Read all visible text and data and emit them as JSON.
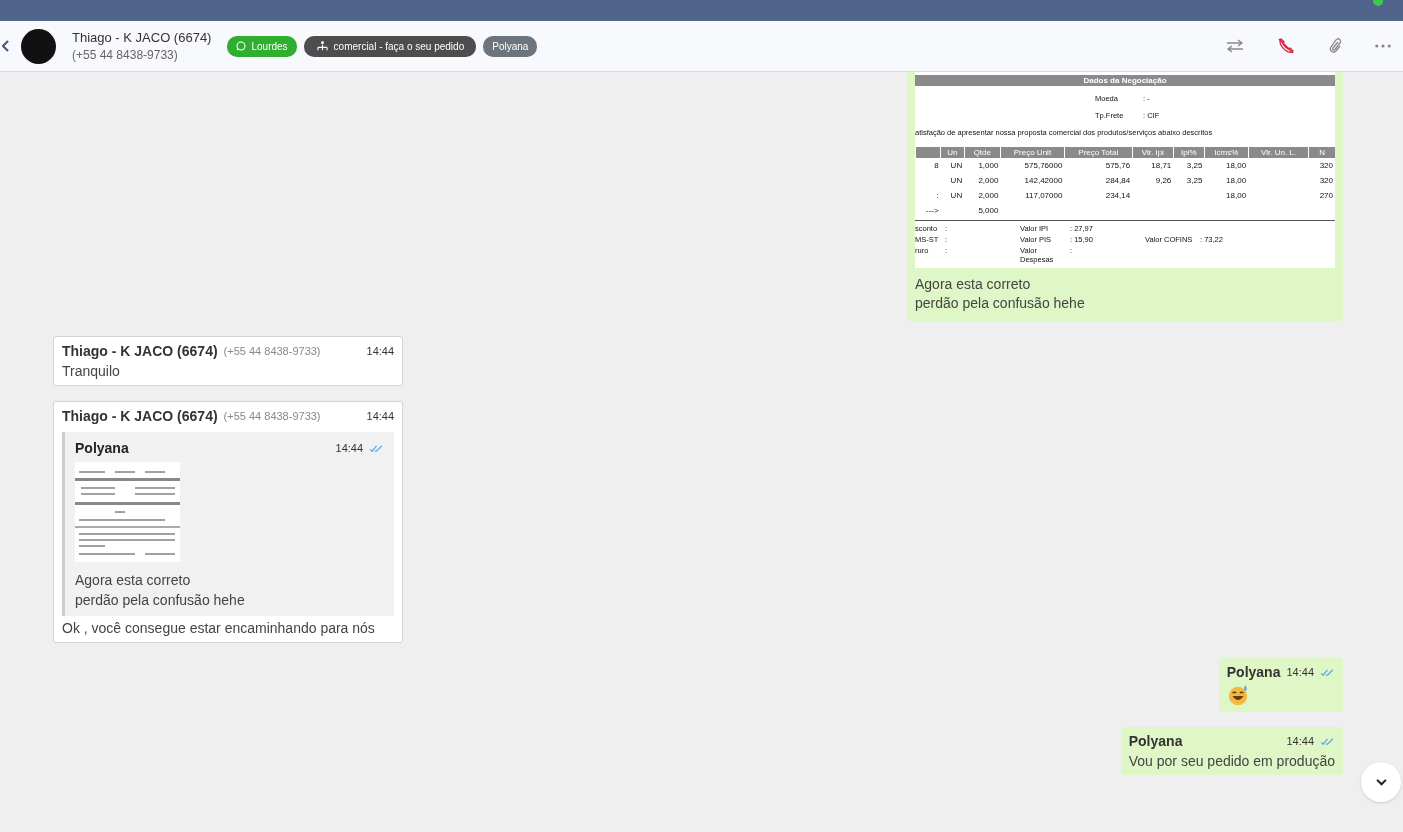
{
  "header": {
    "contact_name": "Thiago - K JACO (6674)",
    "contact_phone": "(+55 44 8438-9733)",
    "tags": [
      {
        "kind": "whatsapp",
        "label": "Lourdes"
      },
      {
        "kind": "queue",
        "label": "comercial - faça o seu pedido"
      },
      {
        "kind": "user",
        "label": "Polyana"
      }
    ]
  },
  "messages": [
    {
      "kind": "image",
      "outgoing": true,
      "document": {
        "title": "Dados da Negociação",
        "fields": [
          {
            "label": "Moeda",
            "value": ": -"
          },
          {
            "label": "Tp.Frete",
            "value": ": CIF"
          }
        ],
        "intro": "atisfação de apresentar nossa proposta comercial dos produtos/serviços abaixo descritos",
        "columns": [
          "",
          "Un",
          "Qtde",
          "Preço Unit",
          "Preço Total",
          "Vlr. Ipi",
          "Ipi%",
          "Icms%",
          "Vlr. Un. L.",
          "N"
        ],
        "rows": [
          [
            "8",
            "UN",
            "1,000",
            "575,76000",
            "575,76",
            "18,71",
            "3,25",
            "18,00",
            "",
            "320"
          ],
          [
            "",
            "UN",
            "2,000",
            "142,42000",
            "284,84",
            "9,26",
            "3,25",
            "18,00",
            "",
            "320"
          ],
          [
            ":",
            "UN",
            "2,000",
            "117,07000",
            "234,14",
            "",
            "",
            "18,00",
            "",
            "270"
          ],
          [
            "--->",
            "",
            "5,000"
          ]
        ],
        "totals": [
          [
            "sconto",
            ":",
            "Valor IPI",
            ": 27,97"
          ],
          [
            "MS-ST",
            ":",
            "Valor PIS",
            ": 15,90",
            "Valor COFINS",
            ": 73,22"
          ],
          [
            "ruro",
            ":",
            "Valor Despesas",
            ":"
          ]
        ]
      },
      "caption_lines": [
        "Agora esta correto",
        "perdão pela confusão hehe"
      ]
    },
    {
      "kind": "text",
      "outgoing": false,
      "sender": "Thiago - K JACO (6674)",
      "phone": "(+55 44 8438-9733)",
      "time": "14:44",
      "text": "Tranquilo"
    },
    {
      "kind": "quote",
      "outgoing": false,
      "sender": "Thiago - K JACO (6674)",
      "phone": "(+55 44 8438-9733)",
      "time": "14:44",
      "quote": {
        "sender": "Polyana",
        "time": "14:44",
        "read": true,
        "caption_lines": [
          "Agora esta correto",
          "perdão pela confusão hehe"
        ]
      },
      "text": "Ok , você consegue estar encaminhando para nós"
    },
    {
      "kind": "emoji",
      "outgoing": true,
      "sender": "Polyana",
      "time": "14:44",
      "read": true
    },
    {
      "kind": "text",
      "outgoing": true,
      "sender": "Polyana",
      "time": "14:44",
      "read": true,
      "text": "Vou por seu pedido em produção"
    }
  ]
}
